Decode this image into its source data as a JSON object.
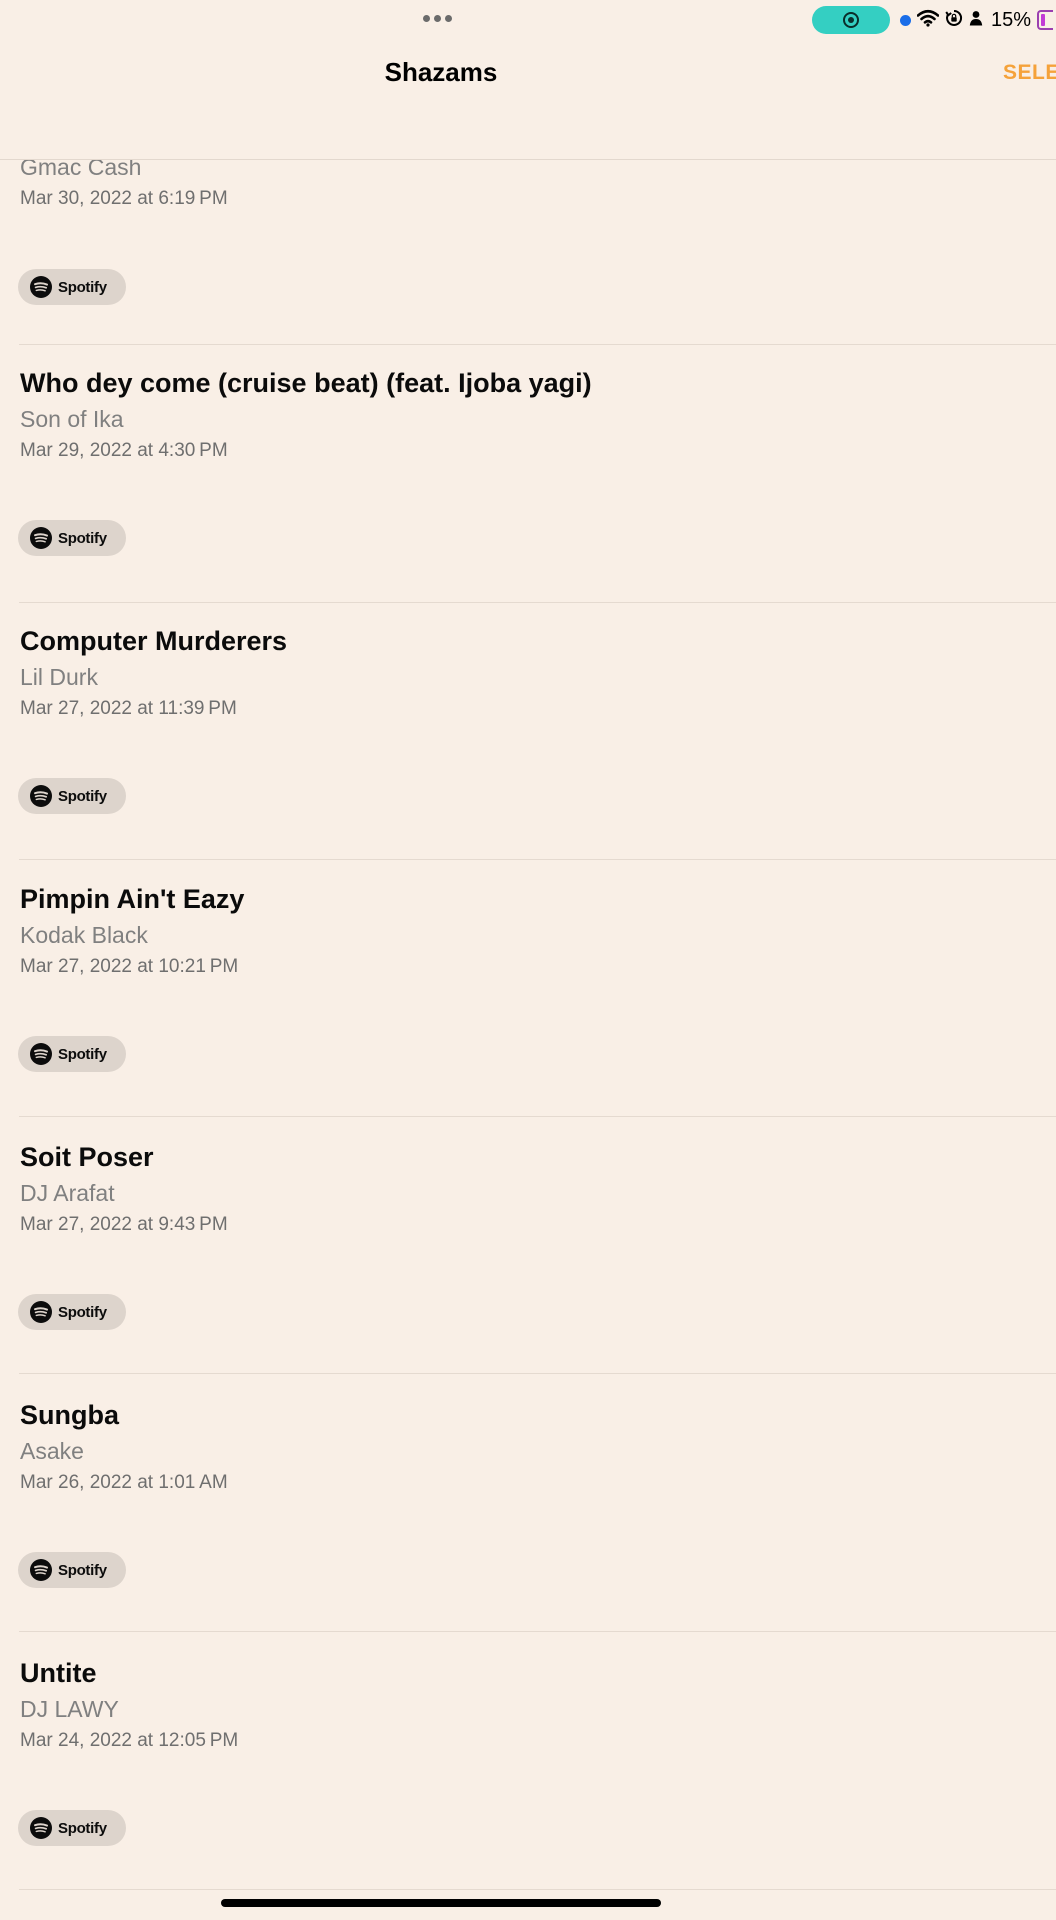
{
  "status_bar": {
    "battery_percent": "15%",
    "accent_colors": {
      "record_pill": "#34cfc2",
      "mic_dot": "#1a6de8",
      "battery": "#c23ad6"
    }
  },
  "header": {
    "title": "Shazams",
    "select_label": "SELE",
    "accent": "#f5a23a"
  },
  "list": {
    "items": [
      {
        "title": "",
        "artist": "Gmac Cash",
        "date": "Mar 30, 2022 at 6:19 PM",
        "service": "Spotify"
      },
      {
        "title": "Who dey come (cruise beat) (feat. Ijoba yagi)",
        "artist": "Son of Ika",
        "date": "Mar 29, 2022 at 4:30 PM",
        "service": "Spotify"
      },
      {
        "title": "Computer Murderers",
        "artist": "Lil Durk",
        "date": "Mar 27, 2022 at 11:39 PM",
        "service": "Spotify"
      },
      {
        "title": "Pimpin Ain't Eazy",
        "artist": "Kodak Black",
        "date": "Mar 27, 2022 at 10:21 PM",
        "service": "Spotify"
      },
      {
        "title": "Soit Poser",
        "artist": "DJ Arafat",
        "date": "Mar 27, 2022 at 9:43 PM",
        "service": "Spotify"
      },
      {
        "title": "Sungba",
        "artist": "Asake",
        "date": "Mar 26, 2022 at 1:01 AM",
        "service": "Spotify"
      },
      {
        "title": "Untite",
        "artist": "DJ LAWY",
        "date": "Mar 24, 2022 at 12:05 PM",
        "service": "Spotify"
      }
    ]
  }
}
